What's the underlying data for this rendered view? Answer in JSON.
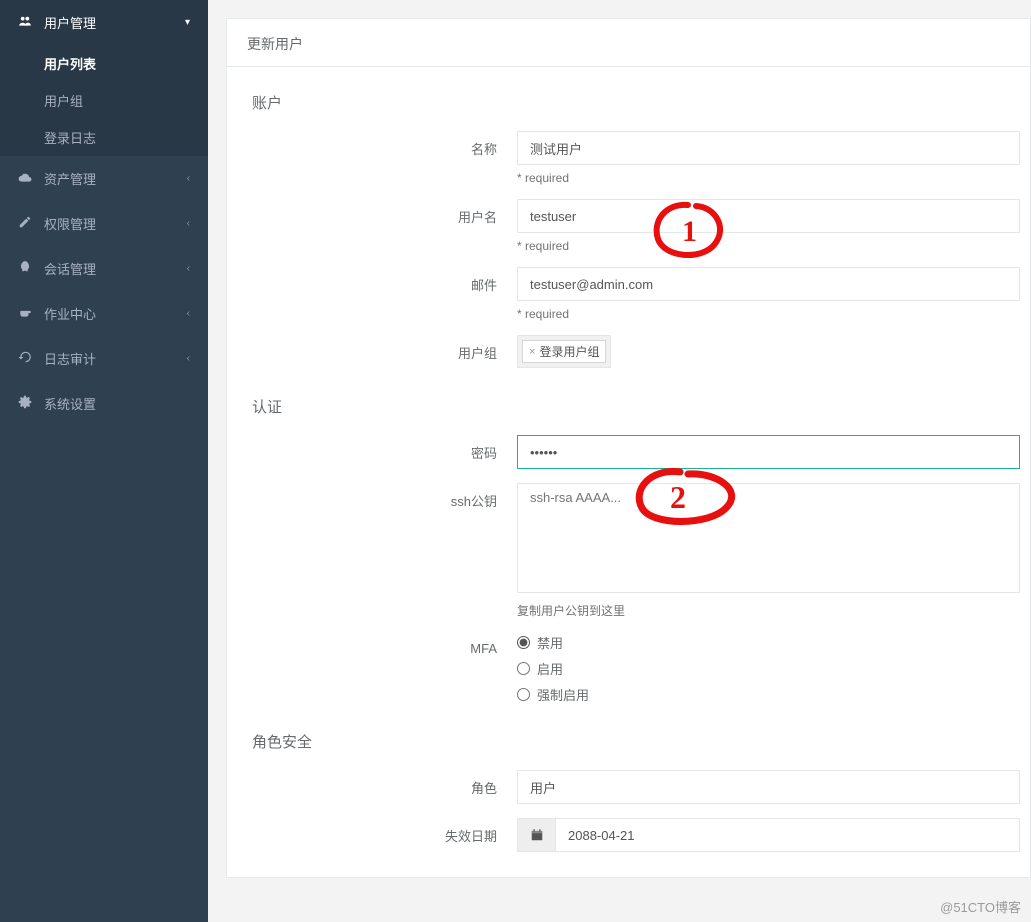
{
  "sidebar": {
    "items": [
      {
        "label": "用户管理",
        "icon": "users-icon",
        "expanded": true,
        "children": [
          {
            "label": "用户列表",
            "active": true
          },
          {
            "label": "用户组"
          },
          {
            "label": "登录日志"
          }
        ]
      },
      {
        "label": "资产管理",
        "icon": "cloud-icon"
      },
      {
        "label": "权限管理",
        "icon": "edit-icon"
      },
      {
        "label": "会话管理",
        "icon": "rocket-icon"
      },
      {
        "label": "作业中心",
        "icon": "coffee-icon"
      },
      {
        "label": "日志审计",
        "icon": "history-icon"
      },
      {
        "label": "系统设置",
        "icon": "cogs-icon"
      }
    ]
  },
  "page": {
    "title": "更新用户"
  },
  "form": {
    "sections": {
      "account": {
        "title": "账户"
      },
      "auth": {
        "title": "认证"
      },
      "role_security": {
        "title": "角色安全"
      }
    },
    "labels": {
      "name": "名称",
      "username": "用户名",
      "email": "邮件",
      "usergroup": "用户组",
      "password": "密码",
      "ssh_key": "ssh公钥",
      "mfa": "MFA",
      "role": "角色",
      "expire_date": "失效日期",
      "required": "* required"
    },
    "values": {
      "name": "测试用户",
      "username": "testuser",
      "email": "testuser@admin.com",
      "usergroup_tag": "登录用户组",
      "password": "••••••",
      "ssh_key": "",
      "ssh_key_placeholder": "ssh-rsa AAAA...",
      "ssh_key_help": "复制用户公钥到这里",
      "mfa_options": [
        "禁用",
        "启用",
        "强制启用"
      ],
      "mfa_selected": "禁用",
      "role": "用户",
      "expire_date": "2088-04-21"
    }
  },
  "annotations": {
    "one": "1",
    "two": "2"
  },
  "watermark": "@51CTO博客"
}
